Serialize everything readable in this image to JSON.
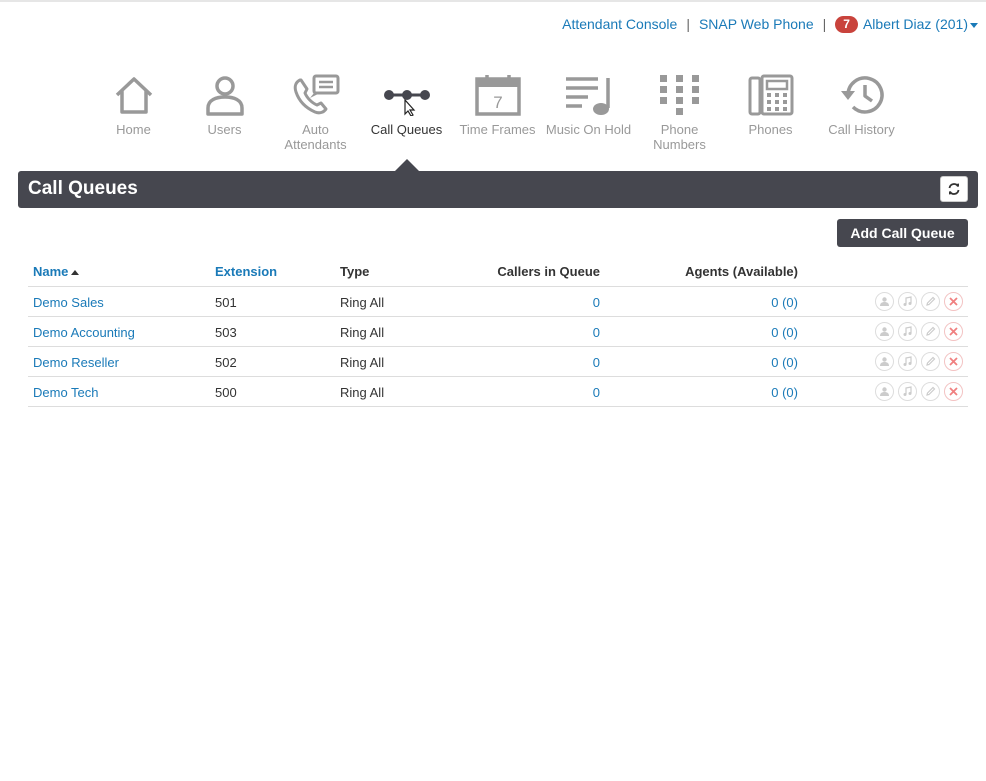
{
  "top_links": {
    "attendant_console": "Attendant Console",
    "separator": "|",
    "snap_web_phone": "SNAP Web Phone",
    "notification_count": "7",
    "user_name": "Albert Diaz (201)"
  },
  "nav": {
    "items": [
      {
        "label": "Home",
        "icon": "home-icon"
      },
      {
        "label": "Users",
        "icon": "user-icon"
      },
      {
        "label": "Auto Attendants",
        "icon": "auto-attendant-icon"
      },
      {
        "label": "Call Queues",
        "icon": "call-queue-icon",
        "active": true
      },
      {
        "label": "Time Frames",
        "icon": "calendar-icon"
      },
      {
        "label": "Music On Hold",
        "icon": "music-icon"
      },
      {
        "label": "Phone Numbers",
        "icon": "keypad-icon"
      },
      {
        "label": "Phones",
        "icon": "desk-phone-icon"
      },
      {
        "label": "Call History",
        "icon": "history-icon"
      }
    ],
    "calendar_day": "7"
  },
  "panel": {
    "title": "Call Queues",
    "add_button": "Add Call Queue"
  },
  "table": {
    "headers": {
      "name": "Name",
      "extension": "Extension",
      "type": "Type",
      "callers": "Callers in Queue",
      "agents": "Agents (Available)"
    },
    "rows": [
      {
        "name": "Demo Sales",
        "extension": "501",
        "type": "Ring All",
        "callers": "0",
        "agents": "0 (0)"
      },
      {
        "name": "Demo Accounting",
        "extension": "503",
        "type": "Ring All",
        "callers": "0",
        "agents": "0 (0)"
      },
      {
        "name": "Demo Reseller",
        "extension": "502",
        "type": "Ring All",
        "callers": "0",
        "agents": "0 (0)"
      },
      {
        "name": "Demo Tech",
        "extension": "500",
        "type": "Ring All",
        "callers": "0",
        "agents": "0 (0)"
      }
    ]
  },
  "colors": {
    "link": "#1a7ab8",
    "header_bg": "#46474f",
    "badge": "#c9433c",
    "icon_gray": "#999999",
    "icon_active": "#46474f"
  }
}
